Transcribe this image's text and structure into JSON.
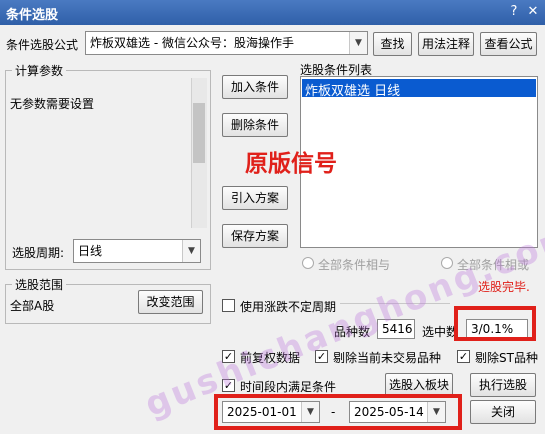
{
  "window": {
    "title": "条件选股",
    "help_icon": "help-icon",
    "close_icon": "close-icon"
  },
  "formula": {
    "label": "条件选股公式",
    "value": "炸板双雄选  -  微信公众号：股海操作手",
    "find_btn": "查找",
    "usage_btn": "用法注释",
    "view_btn": "查看公式"
  },
  "params": {
    "group_title": "计算参数",
    "text": "无参数需要设置"
  },
  "period": {
    "label": "选股周期:",
    "value": "日线"
  },
  "scope": {
    "group_title": "选股范围",
    "value": "全部A股",
    "change_btn": "改变范围"
  },
  "buttons": {
    "add": "加入条件",
    "delete": "删除条件",
    "import": "引入方案",
    "save": "保存方案",
    "to_block": "选股入板块",
    "execute": "执行选股",
    "close": "关闭"
  },
  "conditions": {
    "title": "选股条件列表",
    "items": [
      "炸板双雄选  日线"
    ]
  },
  "overlay_text": "原版信号",
  "logic": {
    "and_label": "全部条件相与",
    "or_label": "全部条件相或"
  },
  "status": {
    "text": "选股完毕.",
    "color": "#e0201a"
  },
  "unfixed_period": {
    "label": "使用涨跌不定周期",
    "checked": false
  },
  "stats": {
    "count_label": "品种数",
    "count_value": "5416",
    "selected_label": "选中数",
    "selected_value": "3/0.1%"
  },
  "options": [
    {
      "label": "前复权数据",
      "checked": true
    },
    {
      "label": "剔除当前未交易品种",
      "checked": true
    },
    {
      "label": "剔除ST品种",
      "checked": true
    }
  ],
  "time_range": {
    "label": "时间段内满足条件",
    "checked": true,
    "start": "2025-01-01",
    "separator": "-",
    "end": "2025-05-14"
  },
  "watermark": "gushichanghong.com",
  "colors": {
    "titlebar": "#2f5fa8",
    "highlight": "#0a5bd0",
    "red": "#e0201a"
  }
}
